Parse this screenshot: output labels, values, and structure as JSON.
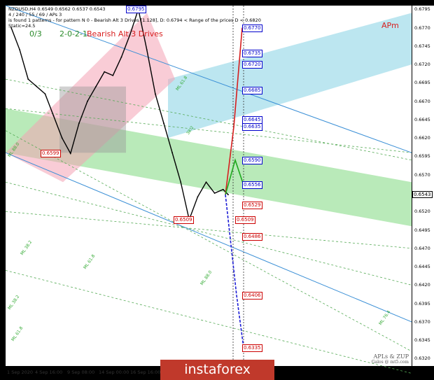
{
  "header": {
    "symbol_line": "NZDUSD,H4  0.6549 0.6562 0.6537 0.6543",
    "info_line": "4 / 240 / 55 / 69 / APs 3",
    "pattern_line": "is found 1 patterns  -  for pattern N 0 - Bearish Alt 3 Drives [1.128], D: 0.6794 < Range of the prices D < 0.6820",
    "static_line": "Static=24.5"
  },
  "labels": {
    "ratio_left": "0/3",
    "ratio_mid": "2-0-2-1",
    "pattern_name": "Bearish Alt 3 Drives",
    "apm": "APm",
    "fan_labels": [
      "ML 38.2",
      "ML 61.8",
      "ML 88.0",
      "ML 38.2",
      "ML 61.8",
      "ML 76.4",
      "ML 88.0",
      "ML 61.8",
      "38.2"
    ]
  },
  "x_axis_labels": [
    "1 Sep 2020",
    "4 Sep 16:00",
    "9 Sep 08:00",
    "14 Sep 00:00",
    "16 Sep 16:00"
  ],
  "credit": {
    "line1": "APLs & ZUP",
    "line2": "Galos @ mt5.com"
  },
  "watermark": "instaforex",
  "chart_data": {
    "type": "line",
    "title": "NZDUSD,H4",
    "ylim": [
      0.631,
      0.68
    ],
    "yticks": [
      0.6795,
      0.677,
      0.6745,
      0.672,
      0.6695,
      0.667,
      0.6645,
      0.662,
      0.6595,
      0.657,
      0.6545,
      0.652,
      0.6495,
      0.647,
      0.6445,
      0.642,
      0.6395,
      0.637,
      0.6345,
      0.632
    ],
    "current_price": "0.6543",
    "price_series": [
      {
        "t": 0,
        "v": 0.677
      },
      {
        "t": 5,
        "v": 0.674
      },
      {
        "t": 10,
        "v": 0.67
      },
      {
        "t": 15,
        "v": 0.669
      },
      {
        "t": 20,
        "v": 0.668
      },
      {
        "t": 25,
        "v": 0.665
      },
      {
        "t": 30,
        "v": 0.662
      },
      {
        "t": 35,
        "v": 0.6599
      },
      {
        "t": 40,
        "v": 0.664
      },
      {
        "t": 45,
        "v": 0.667
      },
      {
        "t": 50,
        "v": 0.669
      },
      {
        "t": 55,
        "v": 0.671
      },
      {
        "t": 60,
        "v": 0.6705
      },
      {
        "t": 65,
        "v": 0.673
      },
      {
        "t": 70,
        "v": 0.676
      },
      {
        "t": 75,
        "v": 0.6795
      },
      {
        "t": 80,
        "v": 0.674
      },
      {
        "t": 85,
        "v": 0.668
      },
      {
        "t": 90,
        "v": 0.664
      },
      {
        "t": 95,
        "v": 0.66
      },
      {
        "t": 100,
        "v": 0.656
      },
      {
        "t": 105,
        "v": 0.6509
      },
      {
        "t": 110,
        "v": 0.654
      },
      {
        "t": 115,
        "v": 0.656
      },
      {
        "t": 120,
        "v": 0.6545
      },
      {
        "t": 125,
        "v": 0.655
      },
      {
        "t": 128,
        "v": 0.6543
      }
    ],
    "levels": [
      {
        "label": "0.6795",
        "value": 0.6795,
        "color": "blue"
      },
      {
        "label": "0.6770",
        "value": 0.677,
        "color": "blue"
      },
      {
        "label": "0.6735",
        "value": 0.6735,
        "color": "blue"
      },
      {
        "label": "0.6720",
        "value": 0.672,
        "color": "blue"
      },
      {
        "label": "0.6685",
        "value": 0.6685,
        "color": "blue"
      },
      {
        "label": "0.6645",
        "value": 0.6645,
        "color": "blue"
      },
      {
        "label": "0.6635",
        "value": 0.6635,
        "color": "blue"
      },
      {
        "label": "0.6599",
        "value": 0.6599,
        "color": "red"
      },
      {
        "label": "0.6590",
        "value": 0.659,
        "color": "blue"
      },
      {
        "label": "0.6556",
        "value": 0.6556,
        "color": "blue"
      },
      {
        "label": "0.6529",
        "value": 0.6529,
        "color": "red"
      },
      {
        "label": "0.6509",
        "value": 0.6509,
        "color": "red"
      },
      {
        "label": "0.6509",
        "value": 0.6509,
        "color": "red"
      },
      {
        "label": "0.6486",
        "value": 0.6486,
        "color": "red"
      },
      {
        "label": "0.6406",
        "value": 0.6406,
        "color": "red"
      },
      {
        "label": "0.6335",
        "value": 0.6335,
        "color": "red"
      }
    ]
  }
}
